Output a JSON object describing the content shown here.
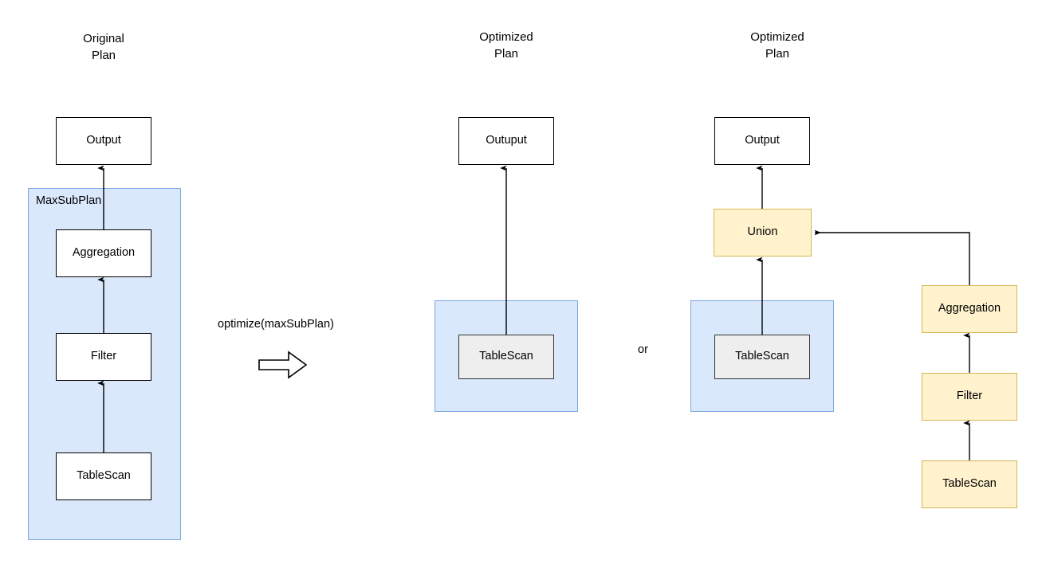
{
  "diagram": {
    "title_columns": [
      {
        "id": "original",
        "label": "Original\nPlan"
      },
      {
        "id": "optimized_a",
        "label": "Optimized\nPlan"
      },
      {
        "id": "optimized_b",
        "label": "Optimized\nPlan"
      }
    ],
    "transform_label": "optimize(maxSubPlan)",
    "alternative_separator": "or",
    "group_labels": {
      "max_sub_plan": "MaxSubPlan"
    },
    "colors": {
      "group_fill": "#dae8fc",
      "group_stroke": "#7ea6e0",
      "node_white_fill": "#ffffff",
      "node_white_stroke": "#000000",
      "node_grey_fill": "#eeeeee",
      "node_grey_stroke": "#333333",
      "node_yellow_fill": "#fff2cc",
      "node_yellow_stroke": "#d6b656",
      "edge_stroke": "#000000"
    },
    "plans": {
      "original": {
        "nodes": [
          {
            "id": "orig-output",
            "label": "Output"
          },
          {
            "id": "orig-aggregation",
            "label": "Aggregation"
          },
          {
            "id": "orig-filter",
            "label": "Filter"
          },
          {
            "id": "orig-tablescan",
            "label": "TableScan"
          }
        ]
      },
      "optimized_a": {
        "nodes": [
          {
            "id": "opt-a-output",
            "label": "Outuput"
          },
          {
            "id": "opt-a-tablescan",
            "label": "TableScan"
          }
        ]
      },
      "optimized_b": {
        "nodes": [
          {
            "id": "opt-b-output",
            "label": "Output"
          },
          {
            "id": "opt-b-union",
            "label": "Union"
          },
          {
            "id": "opt-b-tablescan",
            "label": "TableScan"
          },
          {
            "id": "opt-b-aggregation",
            "label": "Aggregation"
          },
          {
            "id": "opt-b-filter",
            "label": "Filter"
          },
          {
            "id": "opt-b-tablescan-right",
            "label": "TableScan"
          }
        ]
      }
    }
  }
}
